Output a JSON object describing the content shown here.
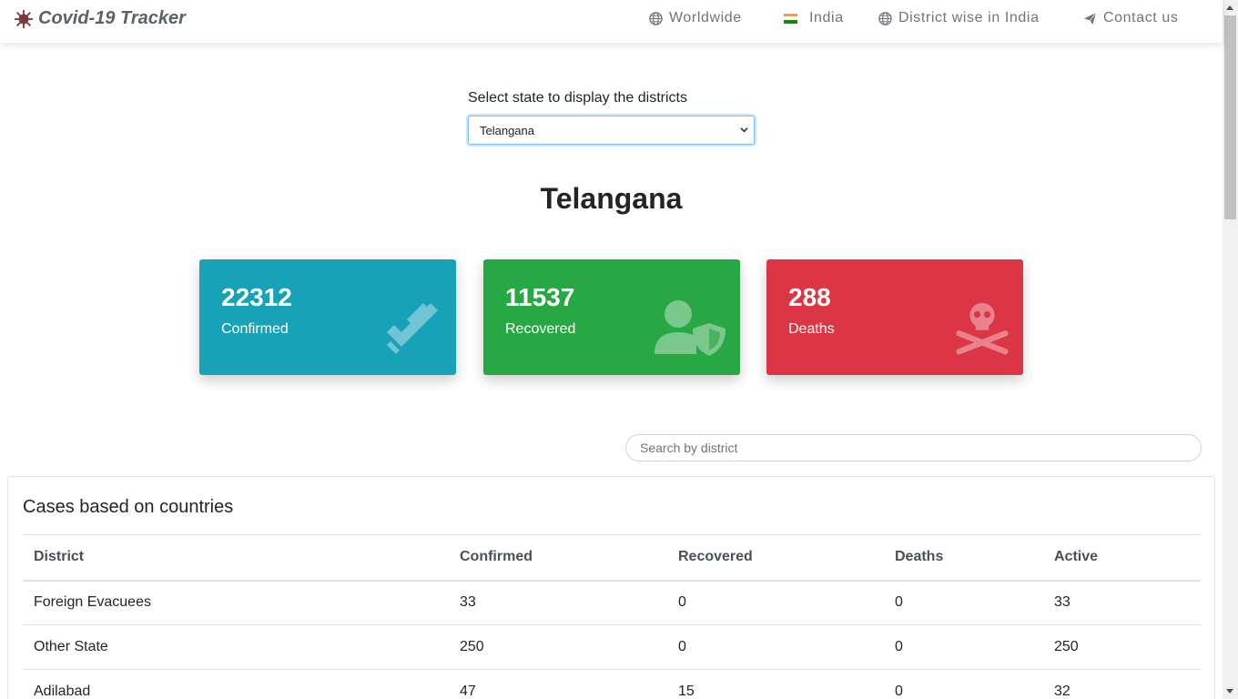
{
  "navbar": {
    "brand": "Covid-19 Tracker",
    "brand_icon": "virus-icon",
    "items": [
      {
        "label": "Worldwide",
        "icon": "globe-icon"
      },
      {
        "label": "India",
        "icon": "india-flag-icon"
      },
      {
        "label": "District wise in India",
        "icon": "globe-icon"
      },
      {
        "label": "Contact us",
        "icon": "paper-plane-icon"
      }
    ]
  },
  "state_select": {
    "label": "Select state to display the districts",
    "selected": "Telangana"
  },
  "state_title": "Telangana",
  "stats": {
    "confirmed": {
      "value": "22312",
      "label": "Confirmed",
      "icon": "double-check-icon",
      "color": "#17a2b8"
    },
    "recovered": {
      "value": "11537",
      "label": "Recovered",
      "icon": "user-shield-icon",
      "color": "#28a745"
    },
    "deaths": {
      "value": "288",
      "label": "Deaths",
      "icon": "skull-crossbones-icon",
      "color": "#dc3545"
    }
  },
  "search": {
    "placeholder": "Search by district"
  },
  "table": {
    "title": "Cases based on countries",
    "headers": [
      "District",
      "Confirmed",
      "Recovered",
      "Deaths",
      "Active"
    ],
    "rows": [
      [
        "Foreign Evacuees",
        "33",
        "0",
        "0",
        "33"
      ],
      [
        "Other State",
        "250",
        "0",
        "0",
        "250"
      ],
      [
        "Adilabad",
        "47",
        "15",
        "0",
        "32"
      ]
    ]
  }
}
